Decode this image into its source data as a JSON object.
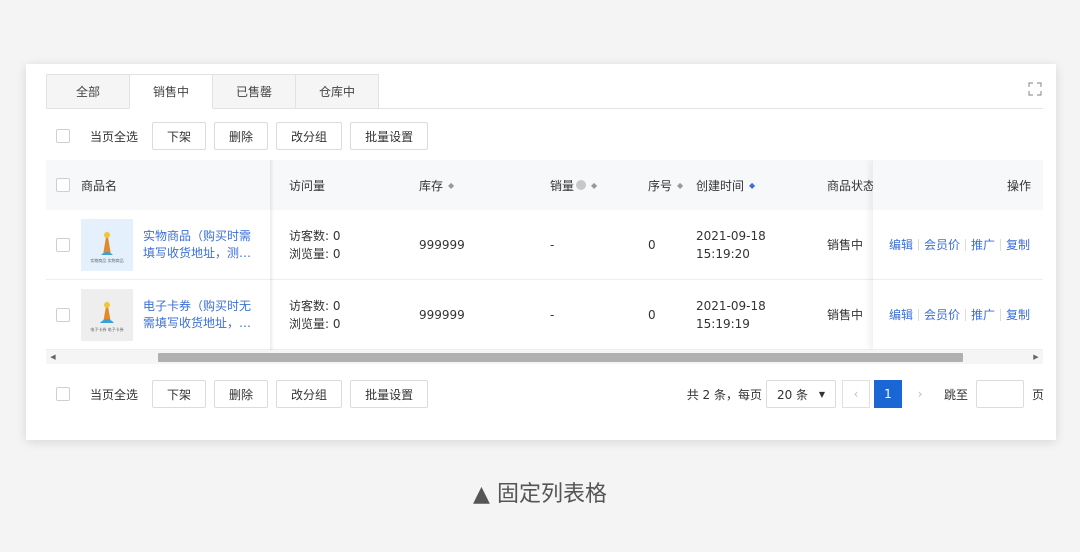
{
  "tabs": [
    "全部",
    "销售中",
    "已售罄",
    "仓库中"
  ],
  "toolbar": {
    "select_all": "当页全选",
    "buttons": [
      "下架",
      "删除",
      "改分组",
      "批量设置"
    ]
  },
  "table": {
    "headers": {
      "name": "商品名",
      "visits": "访问量",
      "stock": "库存",
      "sales": "销量",
      "seq": "序号",
      "created": "创建时间",
      "status": "商品状态",
      "ops": "操作"
    },
    "sort_icon": "◆",
    "sort_active_icon": "◆",
    "rows": [
      {
        "name": "实物商品（购买时需填写收货地址，测…",
        "visitors": "访客数: 0",
        "views": "浏览量: 0",
        "stock": "999999",
        "sales": "-",
        "seq": "0",
        "date": "2021-09-18",
        "time": "15:19:20",
        "status": "销售中",
        "image_caption": "实物商品 实物商品"
      },
      {
        "name": "电子卡券（购买时无需填写收货地址，…",
        "visitors": "访客数: 0",
        "views": "浏览量: 0",
        "stock": "999999",
        "sales": "-",
        "seq": "0",
        "date": "2021-09-18",
        "time": "15:19:19",
        "status": "销售中",
        "image_caption": "电子卡券 电子卡券"
      }
    ],
    "ops": [
      "编辑",
      "会员价",
      "推广",
      "复制"
    ]
  },
  "pagination": {
    "total": "共 2 条，每页",
    "page_size": "20 条",
    "current": "1",
    "jump_label": "跳至",
    "page_unit": "页"
  },
  "caption": "▲ 固定列表格",
  "colors": {
    "link": "#3b6fd8",
    "primary": "#1a66d4"
  }
}
